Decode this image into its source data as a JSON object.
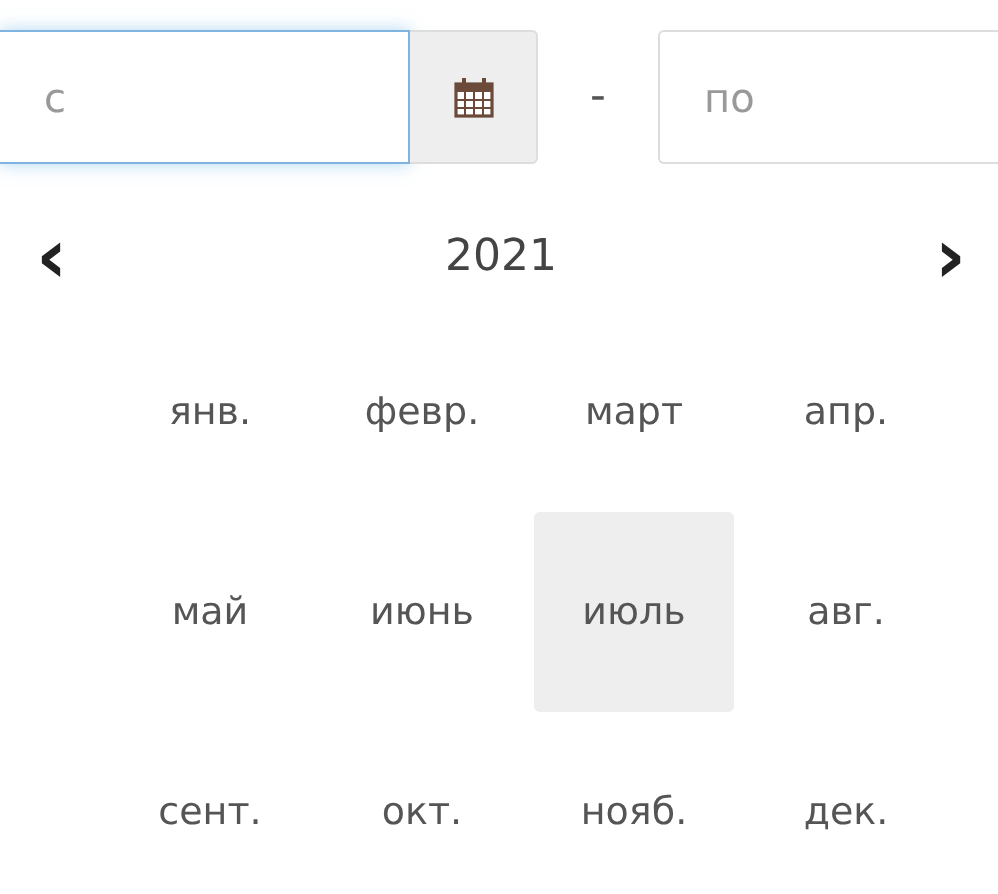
{
  "range": {
    "from": {
      "placeholder": "с",
      "focused": true
    },
    "separator": "-",
    "to": {
      "placeholder": "по",
      "focused": false
    }
  },
  "picker": {
    "year": "2021",
    "prev": "‹",
    "next": "›",
    "months": [
      {
        "label": "янв.",
        "selected": false
      },
      {
        "label": "февр.",
        "selected": false
      },
      {
        "label": "март",
        "selected": false
      },
      {
        "label": "апр.",
        "selected": false
      },
      {
        "label": "май",
        "selected": false
      },
      {
        "label": "июнь",
        "selected": false
      },
      {
        "label": "июль",
        "selected": true
      },
      {
        "label": "авг.",
        "selected": false
      },
      {
        "label": "сент.",
        "selected": false
      },
      {
        "label": "окт.",
        "selected": false
      },
      {
        "label": "нояб.",
        "selected": false
      },
      {
        "label": "дек.",
        "selected": false
      }
    ]
  }
}
